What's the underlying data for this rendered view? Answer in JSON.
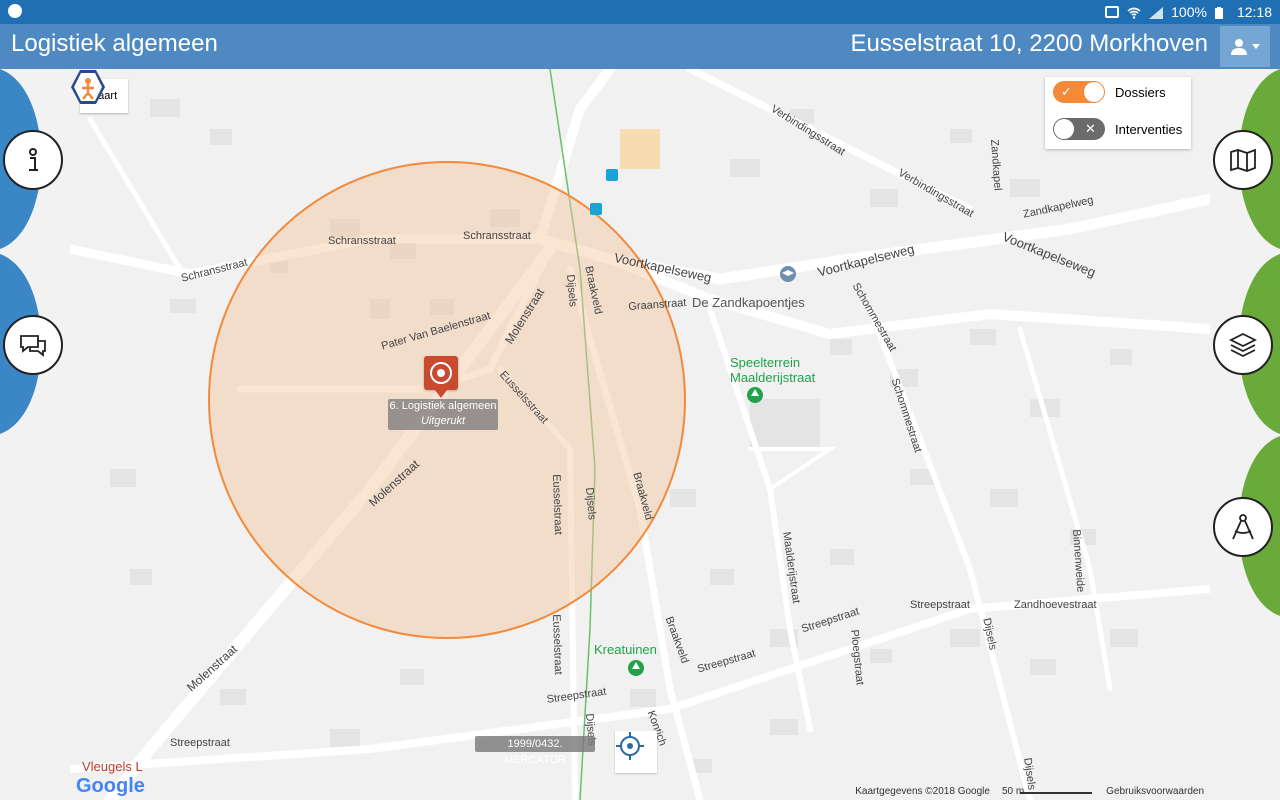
{
  "statusbar": {
    "battery": "100%",
    "time": "12:18"
  },
  "appbar": {
    "title": "Logistiek algemeen",
    "address": "Eusselstraat 10, 2200 Morkhoven"
  },
  "map_controls": {
    "kaart_label": "Kaart",
    "toggles": [
      {
        "label": "Dossiers",
        "on": true
      },
      {
        "label": "Interventies",
        "on": false
      }
    ]
  },
  "pins": {
    "dossier": {
      "line1": "6. Logistiek algemeen",
      "line2": "Uitgerukt"
    },
    "mercator": {
      "label": "1999/0432. MERCATOR"
    }
  },
  "streets": [
    {
      "label": "Schransstraat"
    },
    {
      "label": "Schransstraat"
    },
    {
      "label": "Schransstraat"
    },
    {
      "label": "Pater Van Baelenstraat"
    },
    {
      "label": "Molenstraat"
    },
    {
      "label": "Molenstraat"
    },
    {
      "label": "Molenstraat"
    },
    {
      "label": "Eusselsstraat"
    },
    {
      "label": "Eusselstraat"
    },
    {
      "label": "Eusselstraat"
    },
    {
      "label": "Dijsels"
    },
    {
      "label": "Dijsels"
    },
    {
      "label": "Dijsels"
    },
    {
      "label": "Braakveld"
    },
    {
      "label": "Braakveld"
    },
    {
      "label": "Braakveld"
    },
    {
      "label": "Graanstraat"
    },
    {
      "label": "Voortkapelseweg"
    },
    {
      "label": "Voortkapelseweg"
    },
    {
      "label": "Voortkapelseweg"
    },
    {
      "label": "Verbindingsstraat"
    },
    {
      "label": "Verbindingsstraat"
    },
    {
      "label": "Zandkapel"
    },
    {
      "label": "Zandkapelweg"
    },
    {
      "label": "Schommestraat"
    },
    {
      "label": "Schommestraat"
    },
    {
      "label": "Maalderijstraat"
    },
    {
      "label": "Streepstraat"
    },
    {
      "label": "Streepstraat"
    },
    {
      "label": "Streepstraat"
    },
    {
      "label": "Streepstraat"
    },
    {
      "label": "Streepstraat"
    },
    {
      "label": "Zandhoevestraat"
    },
    {
      "label": "Ploegstraat"
    },
    {
      "label": "Binnenweide"
    },
    {
      "label": "Dijsels"
    },
    {
      "label": "Dijsels"
    },
    {
      "label": "Kontich"
    }
  ],
  "pois": [
    {
      "label": "De Zandkapoentjes"
    },
    {
      "label": "Speelterrein Maalderijstraat"
    },
    {
      "label": "Kreatuinen"
    },
    {
      "label": "Vleugels L"
    }
  ],
  "attribution": {
    "data": "Kaartgegevens ©2018 Google",
    "scale": "50 m",
    "terms": "Gebruiksvoorwaarden",
    "google": "Google"
  },
  "colors": {
    "appbar": "#4e89c1",
    "statusbar": "#1f6fb4",
    "radius_fill": "#f4c39c",
    "radius_stroke": "#f28a3a",
    "toggle_on": "#f28a3a",
    "toggle_off": "#6b6b6b",
    "left_tabs": "#3b86c4",
    "right_tabs": "#6aaa3a"
  },
  "icons": {
    "left": [
      "info-icon",
      "chat-icon"
    ],
    "right": [
      "map-icon",
      "layers-icon",
      "compass-icon"
    ]
  }
}
